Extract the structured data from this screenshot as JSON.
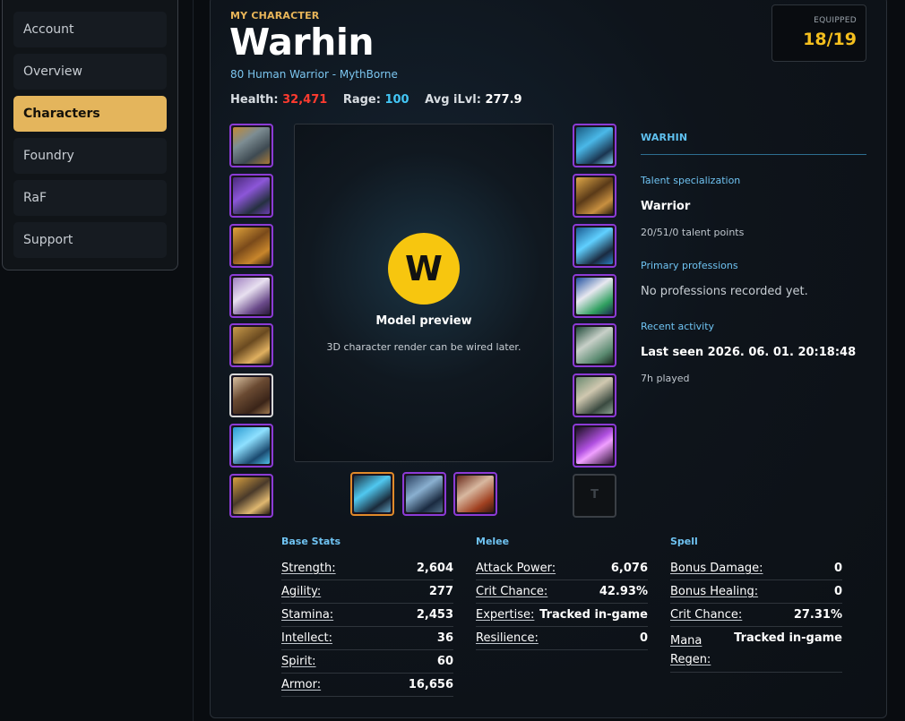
{
  "sidebar": {
    "items": [
      {
        "label": "Account",
        "active": false
      },
      {
        "label": "Overview",
        "active": false
      },
      {
        "label": "Characters",
        "active": true
      },
      {
        "label": "Foundry",
        "active": false
      },
      {
        "label": "RaF",
        "active": false
      },
      {
        "label": "Support",
        "active": false
      }
    ]
  },
  "header": {
    "eyebrow": "MY CHARACTER",
    "name": "Warhin",
    "subtitle": "80 Human Warrior - MythBorne",
    "health_label": "Health:",
    "health_value": "32,471",
    "rage_label": "Rage:",
    "rage_value": "100",
    "ilvl_label": "Avg iLvl:",
    "ilvl_value": "277.9",
    "equipped_label": "EQUIPPED",
    "equipped_value": "18/19"
  },
  "model": {
    "initial": "W",
    "title": "Model preview",
    "note": "3D character render can be wired later."
  },
  "info": {
    "title": "WARHIN",
    "talent_label": "Talent specialization",
    "talent_value": "Warrior",
    "talent_points": "20/51/0 talent points",
    "professions_label": "Primary professions",
    "professions_value": "No professions recorded yet.",
    "activity_label": "Recent activity",
    "last_seen": "Last seen 2026. 06. 01. 20:18:48",
    "played": "7h played"
  },
  "slots": {
    "empty_glyph": "T"
  },
  "stats": {
    "base": {
      "title": "Base Stats",
      "rows": [
        {
          "name": "Strength:",
          "value": "2,604"
        },
        {
          "name": "Agility:",
          "value": "277"
        },
        {
          "name": "Stamina:",
          "value": "2,453"
        },
        {
          "name": "Intellect:",
          "value": "36"
        },
        {
          "name": "Spirit:",
          "value": "60"
        },
        {
          "name": "Armor:",
          "value": "16,656"
        }
      ]
    },
    "melee": {
      "title": "Melee",
      "rows": [
        {
          "name": "Attack Power:",
          "value": "6,076"
        },
        {
          "name": "Crit Chance:",
          "value": "42.93%"
        },
        {
          "name": "Expertise:",
          "value": "Tracked in-game"
        },
        {
          "name": "Resilience:",
          "value": "0"
        }
      ]
    },
    "spell": {
      "title": "Spell",
      "rows": [
        {
          "name": "Bonus Damage:",
          "value": "0"
        },
        {
          "name": "Bonus Healing:",
          "value": "0"
        },
        {
          "name": "Crit Chance:",
          "value": "27.31%"
        },
        {
          "name": "Mana Regen:",
          "value": "Tracked in-game"
        }
      ]
    }
  },
  "colors": {
    "accent": "#e4b55c",
    "health": "#ff3b2f",
    "rage": "#43c6f5",
    "equipped": "#f4bf1e",
    "epic_border": "#8c3bd6"
  }
}
